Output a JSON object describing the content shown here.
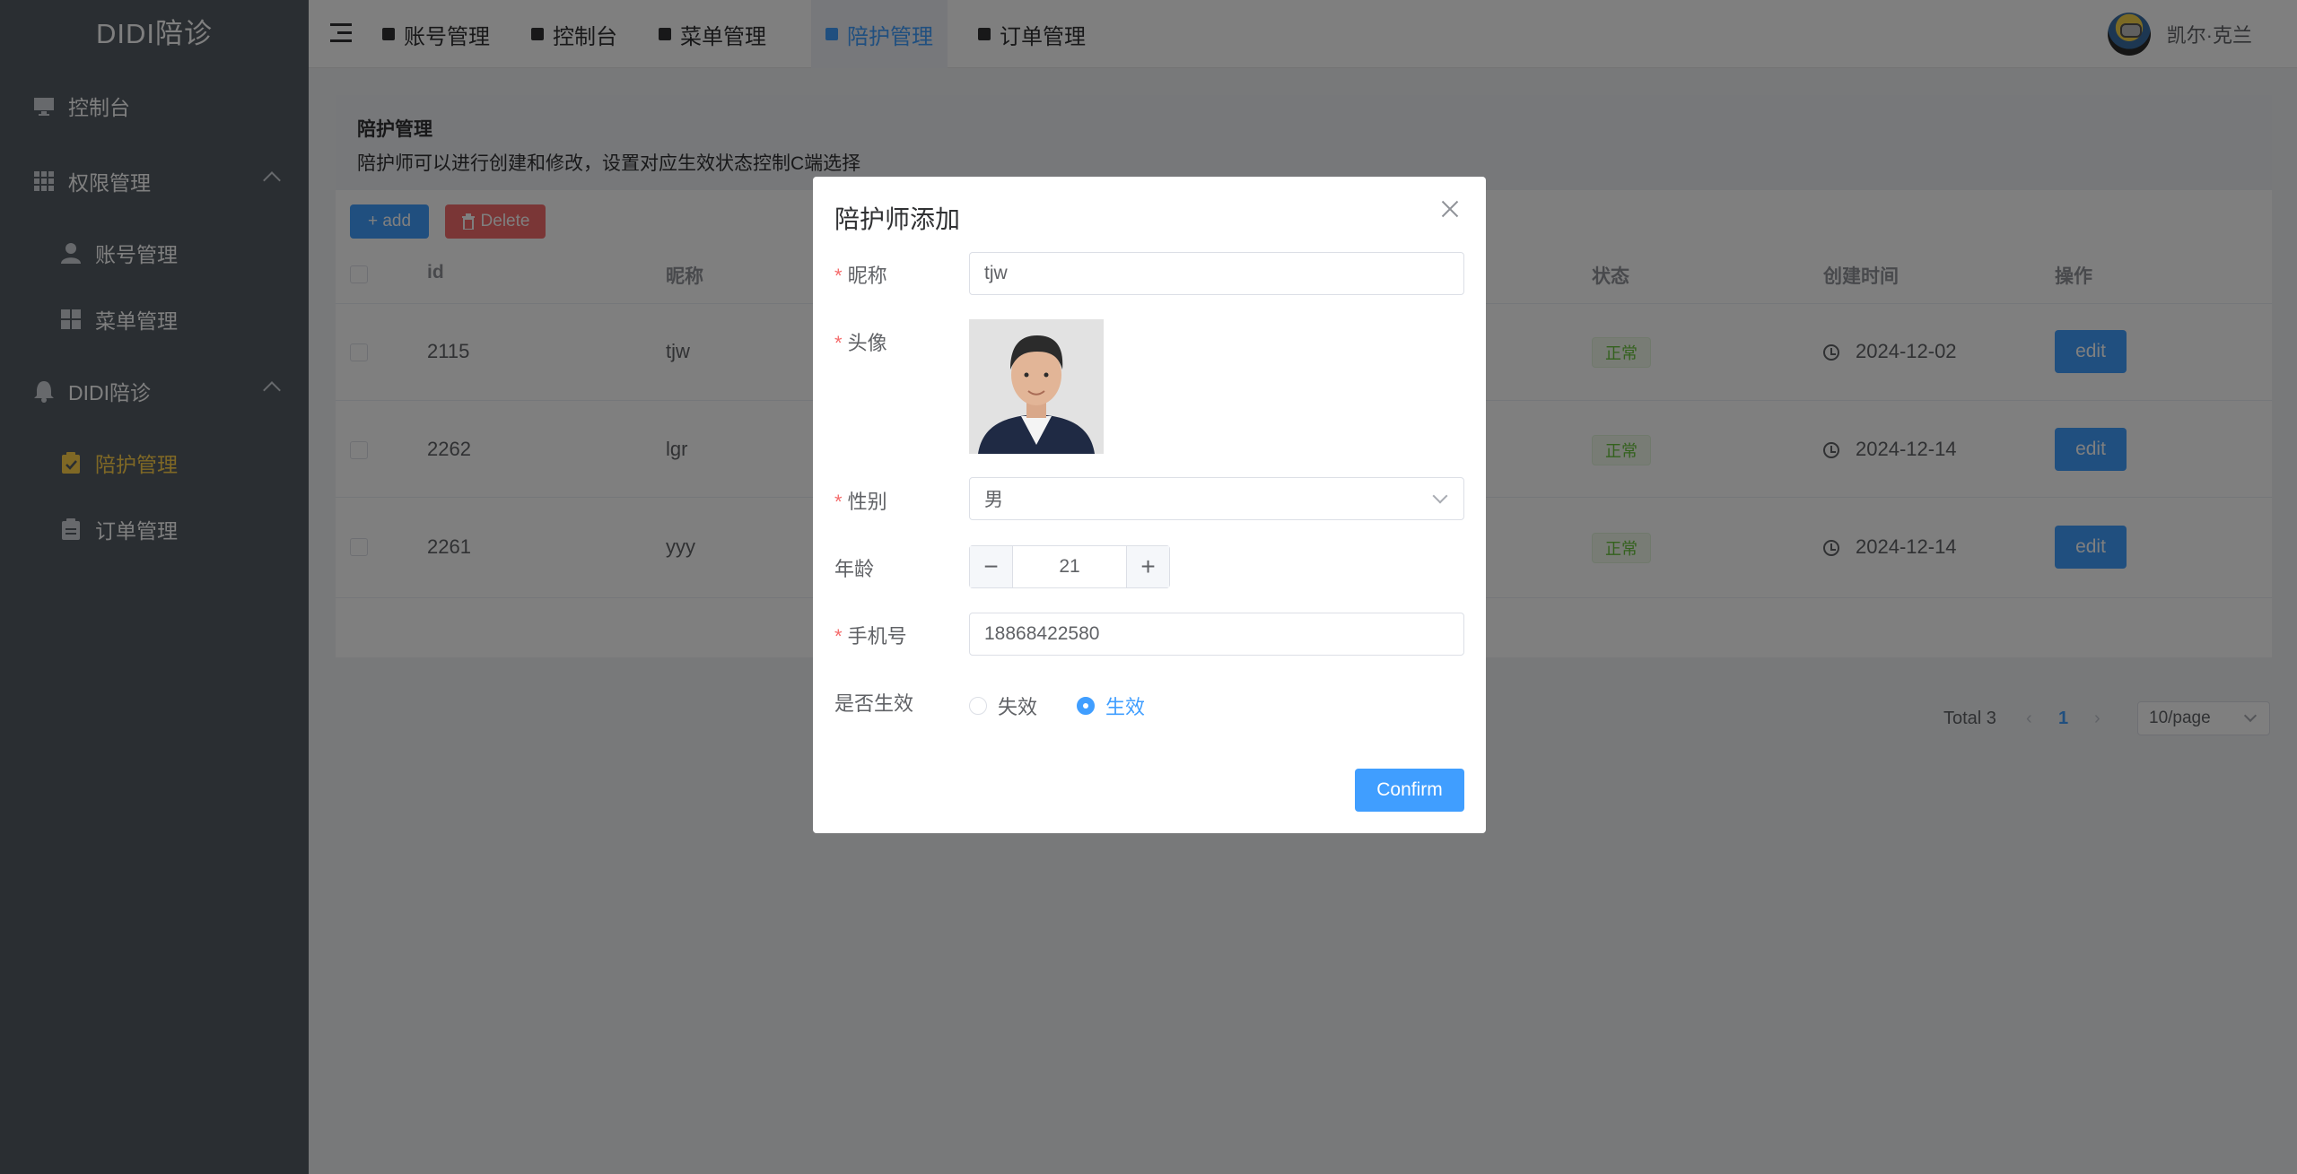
{
  "app": {
    "logo": "DIDI陪诊"
  },
  "sidebar": {
    "items": [
      {
        "label": "控制台"
      },
      {
        "label": "权限管理"
      },
      {
        "label": "账号管理"
      },
      {
        "label": "菜单管理"
      },
      {
        "label": "DIDI陪诊"
      },
      {
        "label": "陪护管理"
      },
      {
        "label": "订单管理"
      }
    ]
  },
  "header": {
    "tabs": [
      {
        "label": "账号管理"
      },
      {
        "label": "控制台"
      },
      {
        "label": "菜单管理"
      },
      {
        "label": "陪护管理"
      },
      {
        "label": "订单管理"
      }
    ],
    "username": "凯尔·克兰"
  },
  "page": {
    "title": "陪护管理",
    "description": "陪护师可以进行创建和修改，设置对应生效状态控制C端选择",
    "add_label": "+ add",
    "delete_label": "Delete"
  },
  "table": {
    "headers": {
      "id": "id",
      "nickname": "昵称",
      "status": "状态",
      "created": "创建时间",
      "actions": "操作"
    },
    "rows": [
      {
        "id": "2115",
        "nickname": "tjw",
        "status": "正常",
        "created": "2024-12-02",
        "action": "edit"
      },
      {
        "id": "2262",
        "nickname": "lgr",
        "status": "正常",
        "created": "2024-12-14",
        "action": "edit"
      },
      {
        "id": "2261",
        "nickname": "yyy",
        "status": "正常",
        "created": "2024-12-14",
        "action": "edit"
      }
    ]
  },
  "pagination": {
    "total": "Total 3",
    "current": "1",
    "page_size": "10/page"
  },
  "dialog": {
    "title": "陪护师添加",
    "fields": {
      "nickname_label": "昵称",
      "nickname_value": "tjw",
      "avatar_label": "头像",
      "gender_label": "性别",
      "gender_value": "男",
      "age_label": "年龄",
      "age_value": "21",
      "phone_label": "手机号",
      "phone_value": "18868422580",
      "active_label": "是否生效",
      "option_inactive": "失效",
      "option_active": "生效"
    },
    "required_mark": "*",
    "confirm_label": "Confirm"
  },
  "colors": {
    "primary": "#409eff",
    "danger": "#f56c6c",
    "success": "#67c23a",
    "sidebar_bg": "#545c64",
    "active_menu": "#ffd04b"
  },
  "icons": [
    "monitor-icon",
    "grid-icon",
    "user-icon",
    "bell-icon",
    "clipboard-icon",
    "clock-icon",
    "hamburger-icon",
    "close-icon"
  ]
}
